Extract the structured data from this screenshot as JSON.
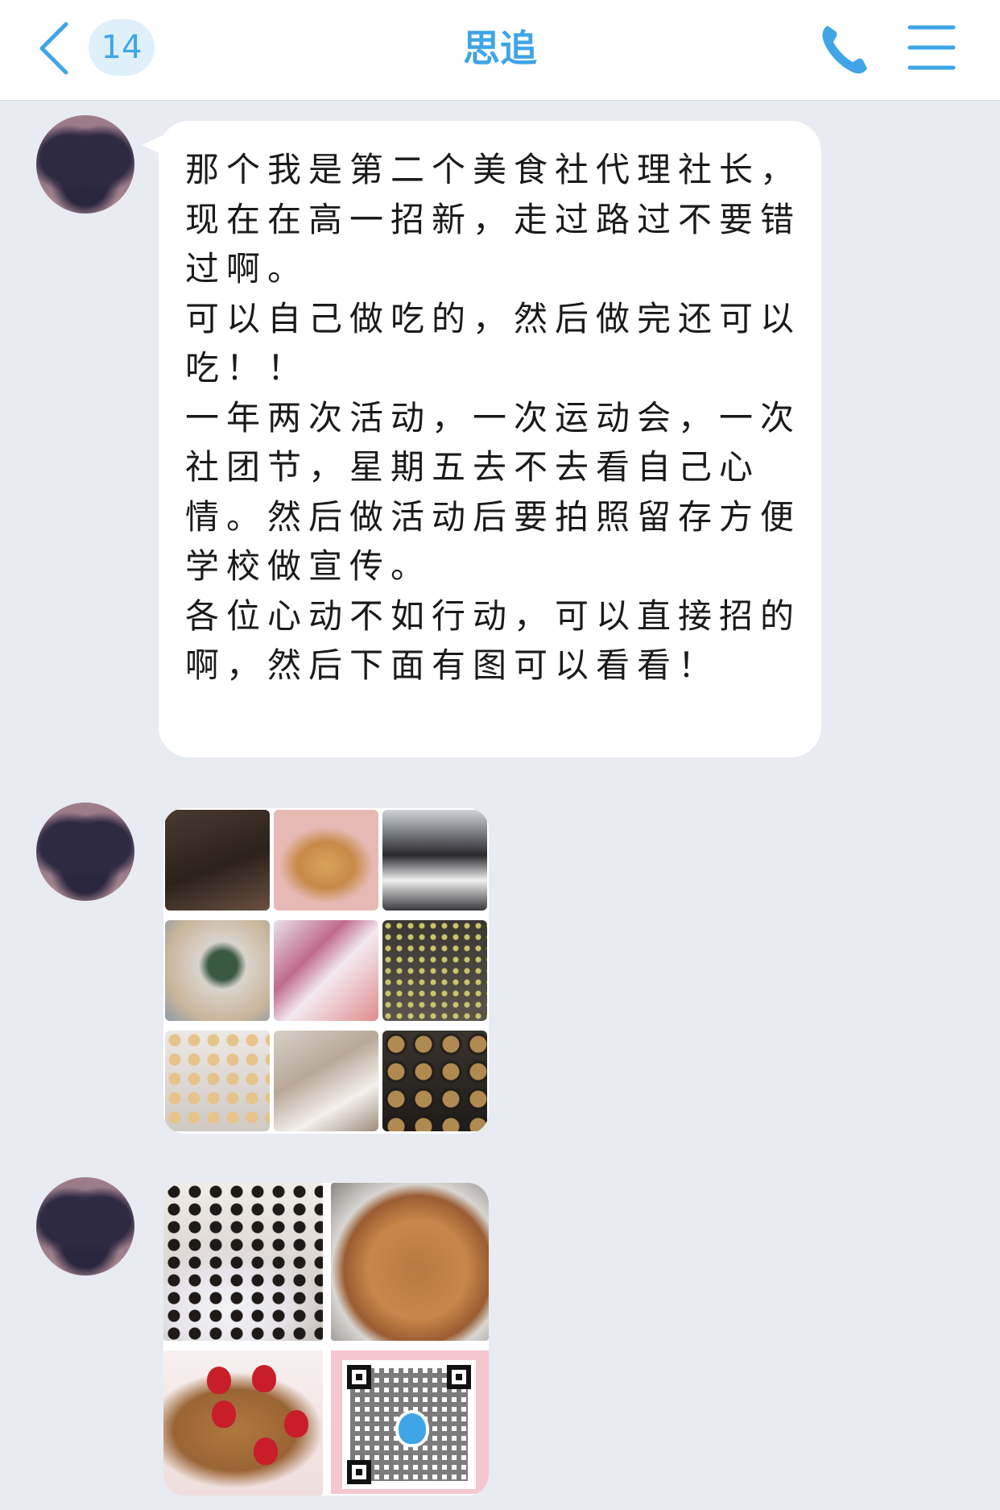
{
  "header": {
    "back_icon": "chevron-left-icon",
    "unread_count": "14",
    "title": "思追",
    "call_icon": "phone-icon",
    "menu_icon": "hamburger-menu-icon"
  },
  "colors": {
    "accent": "#3fa5e6",
    "chat_background": "#e9ebf2",
    "bubble": "#ffffff"
  },
  "messages": [
    {
      "type": "text",
      "text": "那个我是第二个美食社代理社长，现在在高一招新，走过路过不要错过啊。\n可以自己做吃的，然后做完还可以吃！！\n一年两次活动，一次运动会，一次社团节，星期五去不去看自己心情。然后做活动后要拍照留存方便学校做宣传。\n各位心动不如行动，可以直接招的啊，然后下面有图可以看看！"
    },
    {
      "type": "image",
      "image_count": "9"
    },
    {
      "type": "image",
      "image_count": "4"
    }
  ]
}
